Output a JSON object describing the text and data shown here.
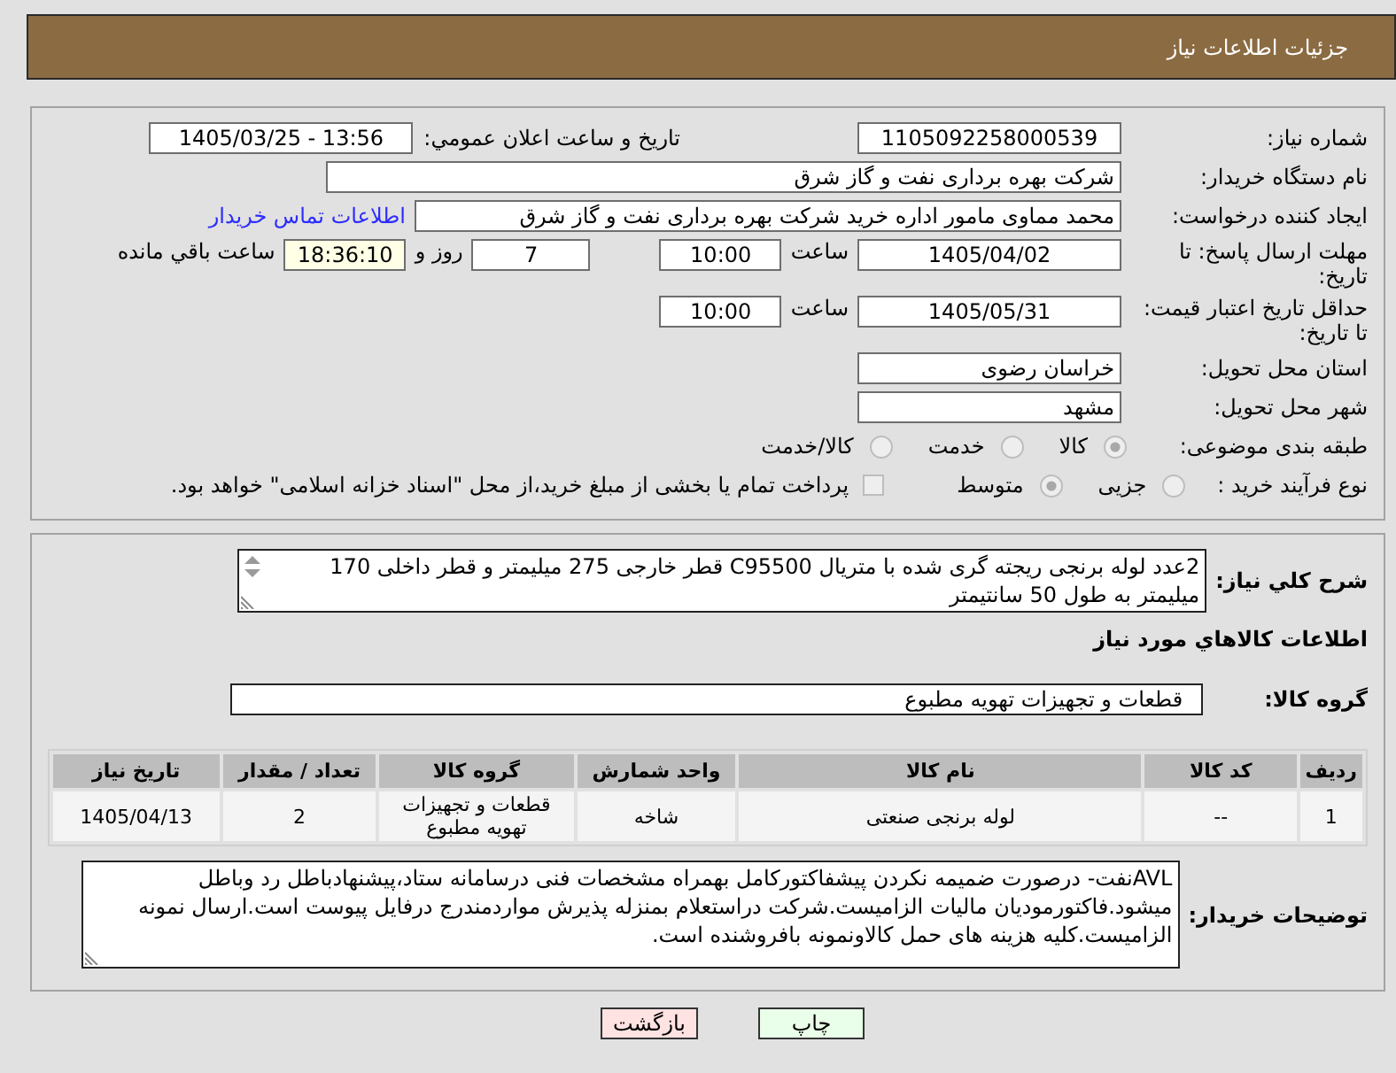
{
  "header": {
    "title": "جزئیات اطلاعات نیاز"
  },
  "general": {
    "rows": [
      {
        "kind": "pair",
        "label": "شماره نیاز:",
        "value": "1105092258000539",
        "second_label": "تاریخ و ساعت اعلان عمومي:",
        "second_value": "1405/03/25 - 13:56"
      },
      {
        "kind": "wide",
        "label": "نام دستگاه خریدار:",
        "value": "شرکت بهره برداری نفت و گاز شرق"
      },
      {
        "kind": "link",
        "label": "ایجاد کننده درخواست:",
        "value": "محمد مماوی مامور اداره خرید شرکت بهره برداری نفت و گاز شرق",
        "link": "اطلاعات تماس خریدار"
      },
      {
        "kind": "deadline",
        "label": "مهلت ارسال پاسخ: تا تاریخ:",
        "date": "1405/04/02",
        "time_label": "ساعت",
        "time": "10:00",
        "days": "7",
        "days_label": "روز و",
        "remaining": "18:36:10",
        "remaining_label": "ساعت باقي مانده"
      },
      {
        "kind": "deadline",
        "label": "حداقل تاریخ اعتبار قیمت: تا تاریخ:",
        "date": "1405/05/31",
        "time_label": "ساعت",
        "time": "10:00"
      },
      {
        "kind": "short",
        "label": "استان محل تحویل:",
        "value": "خراسان رضوی"
      },
      {
        "kind": "short",
        "label": "شهر محل تحویل:",
        "value": "مشهد"
      },
      {
        "kind": "choice",
        "label": "طبقه بندی موضوعی:",
        "disabled": true,
        "options": [
          {
            "label": "کالا",
            "selected": true
          },
          {
            "label": "خدمت",
            "selected": false
          },
          {
            "label": "کالا/خدمت",
            "selected": false
          }
        ]
      },
      {
        "kind": "process",
        "label": "نوع فرآیند خرید :",
        "disabled": true,
        "options": [
          {
            "label": "جزیی",
            "selected": false
          },
          {
            "label": "متوسط",
            "selected": true
          }
        ],
        "checkbox": {
          "label": "پرداخت تمام یا بخشی از مبلغ خرید،از محل \"اسناد خزانه اسلامی\" خواهد بود.",
          "checked": false,
          "disabled": true
        }
      }
    ]
  },
  "goods": {
    "description": {
      "label": "شرح کلي نیاز:",
      "value": "2عدد لوله برنجی ریجته گری شده با متریال C95500 قطر خارجی 275 میلیمتر و قطر داخلی 170 میلیمتر به طول 50 سانتیمتر"
    },
    "heading": "اطلاعات کالاهاي مورد نیاز",
    "group": {
      "label": "گروه کالا:",
      "value": "قطعات و تجهیزات تهویه مطبوع"
    },
    "table": {
      "columns": [
        "ردیف",
        "کد کالا",
        "نام کالا",
        "واحد شمارش",
        "گروه کالا",
        "تعداد / مقدار",
        "تاریخ نیاز"
      ],
      "rows": [
        [
          "1",
          "--",
          "لوله برنجی صنعتی",
          "شاخه",
          "قطعات و تجهیزات تهویه مطبوع",
          "2",
          "1405/04/13"
        ]
      ]
    },
    "buyer_notes": {
      "label": "توضیحات خریدار:",
      "value": "AVLنفت- درصورت ضمیمه نکردن پیشفاکتورکامل بهمراه مشخصات فنی درسامانه ستاد،پیشنهادباطل رد وباطل میشود.فاکتورمودیان مالیات الزامیست.شرکت دراستعلام بمنزله پذیرش مواردمندرج درفایل پیوست است.ارسال نمونه الزامیست.کلیه هزینه های حمل کالاونمونه بافروشنده است."
    }
  },
  "buttons": [
    {
      "kind": "print",
      "label": "چاپ"
    },
    {
      "kind": "back",
      "label": "بازگشت"
    }
  ]
}
